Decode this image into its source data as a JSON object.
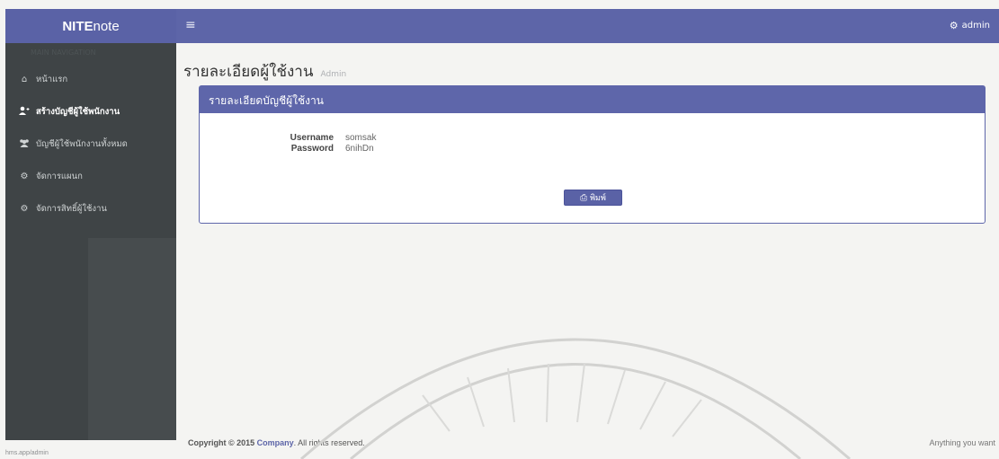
{
  "app": {
    "logo_bold": "NITE",
    "logo_light": "note"
  },
  "sidebar": {
    "header": "MAIN NAVIGATION",
    "items": [
      {
        "icon": "home-icon",
        "label": "หน้าแรก"
      },
      {
        "icon": "user-plus-icon",
        "label": "สร้างบัญชีผู้ใช้พนักงาน"
      },
      {
        "icon": "users-icon",
        "label": "บัญชีผู้ใช้พนักงานทั้งหมด"
      },
      {
        "icon": "cogs-icon",
        "label": "จัดการแผนก"
      },
      {
        "icon": "cogs-icon",
        "label": "จัดการสิทธิ์ผู้ใช้งาน"
      }
    ]
  },
  "topbar": {
    "menu_glyph": "≡",
    "user_label": "admin"
  },
  "page": {
    "title": "รายละเอียดผู้ใช้งาน",
    "subtitle": "Admin"
  },
  "panel": {
    "heading": "รายละเอียดบัญชีผู้ใช้งาน",
    "username_label": "Username",
    "username_value": "somsak",
    "password_label": "Password",
    "password_value": "6nihDn",
    "print_label": "พิมพ์"
  },
  "footer": {
    "copyright_prefix": "Copyright © 2015 ",
    "company": "Company",
    "copyright_suffix": ". All rights reserved.",
    "right_text": "Anything you want"
  },
  "status_bar": {
    "url": "hms.app/admin"
  },
  "colors": {
    "brand": "#5a62a6",
    "sidebar_bg": "#3f4446",
    "page_bg": "#f4f4f2"
  }
}
